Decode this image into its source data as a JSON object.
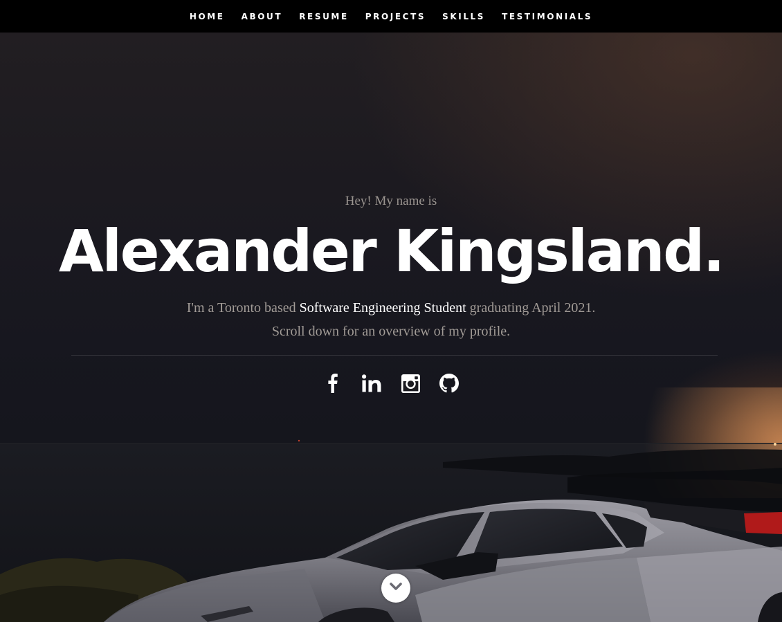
{
  "nav": {
    "items": [
      {
        "label": "HOME"
      },
      {
        "label": "ABOUT"
      },
      {
        "label": "RESUME"
      },
      {
        "label": "PROJECTS"
      },
      {
        "label": "SKILLS"
      },
      {
        "label": "TESTIMONIALS"
      }
    ]
  },
  "hero": {
    "intro": "Hey! My name is",
    "name": "Alexander Kingsland.",
    "tagline_prefix": "I'm a Toronto based ",
    "tagline_highlight": "Software Engineering Student",
    "tagline_suffix": " graduating April 2021.",
    "tagline_line2": "Scroll down for an overview of my profile."
  },
  "social": {
    "icons": [
      "facebook-icon",
      "linkedin-icon",
      "instagram-icon",
      "github-icon"
    ]
  },
  "scroll_button": {
    "icon": "chevron-down-icon"
  },
  "colors": {
    "nav_background": "#000000",
    "nav_text": "#ffffff",
    "name_text": "#ffffff",
    "muted_text": "#a19b96",
    "highlight_text": "#ffffff",
    "car_silver": "#8e8e96",
    "spoiler_red": "#b01a1a"
  }
}
